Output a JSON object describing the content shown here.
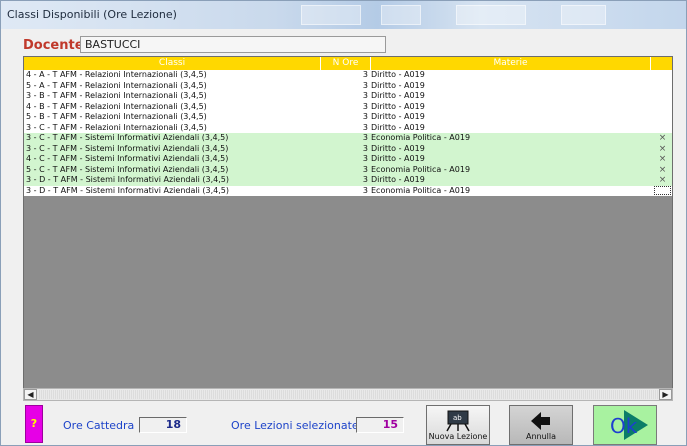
{
  "window": {
    "title": "Classi Disponibili (Ore Lezione)"
  },
  "docente": {
    "label": "Docente",
    "value": "BASTUCCI"
  },
  "table": {
    "headers": [
      "Classi",
      "N Ore",
      "Materie"
    ],
    "rows": [
      {
        "classe": "4 - A - T AFM - Relazioni Internazionali (3,4,5)",
        "ore": "3",
        "materia": "Diritto - A019",
        "selected": false,
        "mark": ""
      },
      {
        "classe": "5 - A - T AFM - Relazioni Internazionali (3,4,5)",
        "ore": "3",
        "materia": "Diritto - A019",
        "selected": false,
        "mark": ""
      },
      {
        "classe": "3 - B - T AFM - Relazioni Internazionali (3,4,5)",
        "ore": "3",
        "materia": "Diritto - A019",
        "selected": false,
        "mark": ""
      },
      {
        "classe": "4 - B - T AFM - Relazioni Internazionali (3,4,5)",
        "ore": "3",
        "materia": "Diritto - A019",
        "selected": false,
        "mark": ""
      },
      {
        "classe": "5 - B - T AFM - Relazioni Internazionali (3,4,5)",
        "ore": "3",
        "materia": "Diritto - A019",
        "selected": false,
        "mark": ""
      },
      {
        "classe": "3 - C - T AFM - Relazioni Internazionali (3,4,5)",
        "ore": "3",
        "materia": "Diritto - A019",
        "selected": false,
        "mark": ""
      },
      {
        "classe": "3 - C - T AFM - Sistemi Informativi Aziendali (3,4,5)",
        "ore": "3",
        "materia": "Economia Politica - A019",
        "selected": true,
        "mark": "×"
      },
      {
        "classe": "3 - C - T AFM - Sistemi Informativi Aziendali (3,4,5)",
        "ore": "3",
        "materia": "Diritto - A019",
        "selected": true,
        "mark": "×"
      },
      {
        "classe": "4 - C - T AFM - Sistemi Informativi Aziendali (3,4,5)",
        "ore": "3",
        "materia": "Diritto - A019",
        "selected": true,
        "mark": "×"
      },
      {
        "classe": "5 - C - T AFM - Sistemi Informativi Aziendali (3,4,5)",
        "ore": "3",
        "materia": "Economia Politica - A019",
        "selected": true,
        "mark": "×"
      },
      {
        "classe": "3 - D - T AFM - Sistemi Informativi Aziendali (3,4,5)",
        "ore": "3",
        "materia": "Diritto - A019",
        "selected": true,
        "mark": "×"
      },
      {
        "classe": "3 - D - T AFM - Sistemi Informativi Aziendali (3,4,5)",
        "ore": "3",
        "materia": "Economia Politica - A019",
        "selected": false,
        "mark": ""
      }
    ]
  },
  "footer": {
    "help_label": "?",
    "ore_cattedra_label": "Ore Cattedra",
    "ore_cattedra_value": "18",
    "ore_lezioni_label": "Ore Lezioni selezionate",
    "ore_lezioni_value": "15",
    "nuova_lezione_label": "Nuova Lezione",
    "nuova_lezione_icon_text": "ab",
    "annulla_label": "Annulla",
    "ok_label": "Ok"
  },
  "colors": {
    "header_bg": "#ffd800",
    "selected_row": "#d2f5cf",
    "docente_label": "#c0392b",
    "footer_label": "#1d43c9",
    "ore_lezioni_value": "#a100a1"
  },
  "icons": [
    "scroll-left-icon",
    "scroll-right-icon",
    "blackboard-icon",
    "back-arrow-icon",
    "ok-arrow-icon"
  ]
}
